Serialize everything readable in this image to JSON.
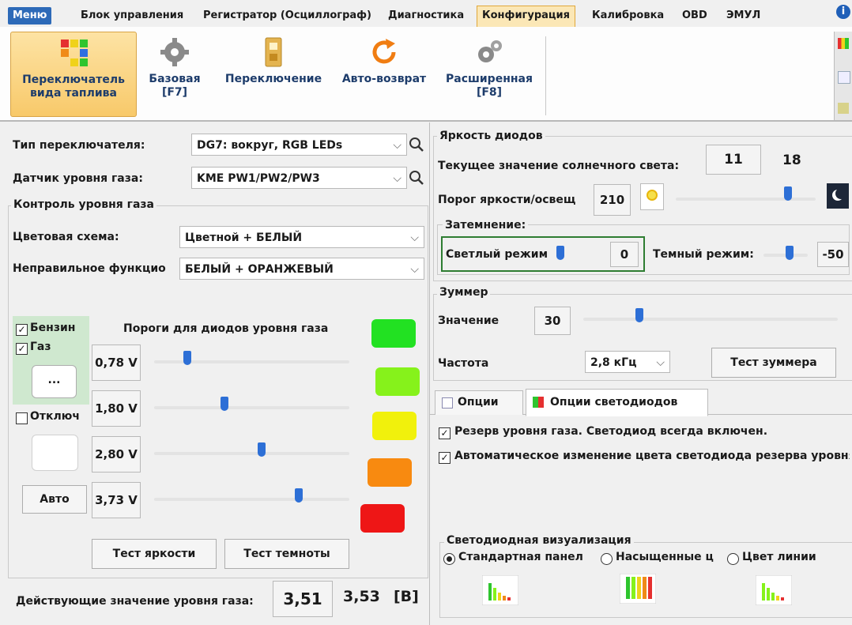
{
  "menu": {
    "tabs": [
      "Меню",
      "Блок управления",
      "Регистратор (Осциллограф)",
      "Диагностика",
      "Конфигурация",
      "Калибровка",
      "OBD",
      "ЭМУЛ"
    ],
    "active": "Конфигурация"
  },
  "ribbon": {
    "buttons": [
      {
        "label1": "Переключатель",
        "label2": "вида таплива",
        "icon": "fuel-switch-icon"
      },
      {
        "label1": "Базовая",
        "label2": "[F7]",
        "icon": "gear-icon"
      },
      {
        "label1": "Переключение",
        "label2": "",
        "icon": "switch-icon"
      },
      {
        "label1": "Авто-возврат",
        "label2": "",
        "icon": "refresh-icon"
      },
      {
        "label1": "Расширенная",
        "label2": "[F8]",
        "icon": "gears-icon"
      }
    ]
  },
  "left": {
    "switch_type_label": "Тип переключателя:",
    "switch_type_value": "DG7: вокруг, RGB LEDs",
    "gas_sensor_label": "Датчик уровня газа:",
    "gas_sensor_value": "KME PW1/PW2/PW3",
    "level_group_title": "Контроль уровня газа",
    "color_scheme_label": "Цветовая схема:",
    "color_scheme_value": "Цветной + БЕЛЫЙ",
    "fault_label": "Неправильное функцио",
    "fault_value": "БЕЛЫЙ + ОРАНЖЕВЫЙ",
    "petrol_label": "Бензин",
    "gas_label": "Газ",
    "dots_label": "...",
    "off_label": "Отключ",
    "auto_label": "Авто",
    "thresholds_title": "Пороги для диодов уровня газа",
    "thresholds": [
      {
        "value": "0,78 V",
        "level": 0.17
      },
      {
        "value": "1,80 V",
        "level": 0.36
      },
      {
        "value": "2,80 V",
        "level": 0.55
      },
      {
        "value": "3,73 V",
        "level": 0.74
      }
    ],
    "led_colors": [
      "#22e122",
      "#86f21b",
      "#f1f10c",
      "#f88a10",
      "#ee1616"
    ],
    "test_bright_label": "Тест яркости",
    "test_dark_label": "Тест темноты",
    "current_level_label": "Действующие значение уровня газа:",
    "current_level_value": "3,51",
    "current_level_raw": "3,53",
    "unit": "[B]"
  },
  "brightness": {
    "title": "Яркость диодов",
    "sun_label": "Текущее значение солнечного света:",
    "sun_value": "11",
    "sun_value2": "18",
    "threshold_label": "Порог яркости/освещ",
    "threshold_value": "210",
    "threshold_level": 0.8,
    "dimming_title": "Затемнение:",
    "light_mode_label": "Светлый режим",
    "light_mode_value": "0",
    "dark_mode_label": "Темный режим:",
    "dark_mode_value": "-50"
  },
  "buzzer": {
    "title": "Зуммер",
    "value_label": "Значение",
    "value": "30",
    "level": 0.22,
    "freq_label": "Частота",
    "freq_value": "2,8 кГц",
    "test_label": "Тест зуммера"
  },
  "options": {
    "tab1": "Опции",
    "tab2": "Опции светодиодов",
    "check1": "Резерв уровня газа. Светодиод всегда включен.",
    "check2": "Автоматическое изменение цвета светодиода резерва уровня",
    "visual_title": "Светодиодная визуализация",
    "radio1": "Стандартная панел",
    "radio2": "Насыщенные ц",
    "radio3": "Цвет линии"
  }
}
